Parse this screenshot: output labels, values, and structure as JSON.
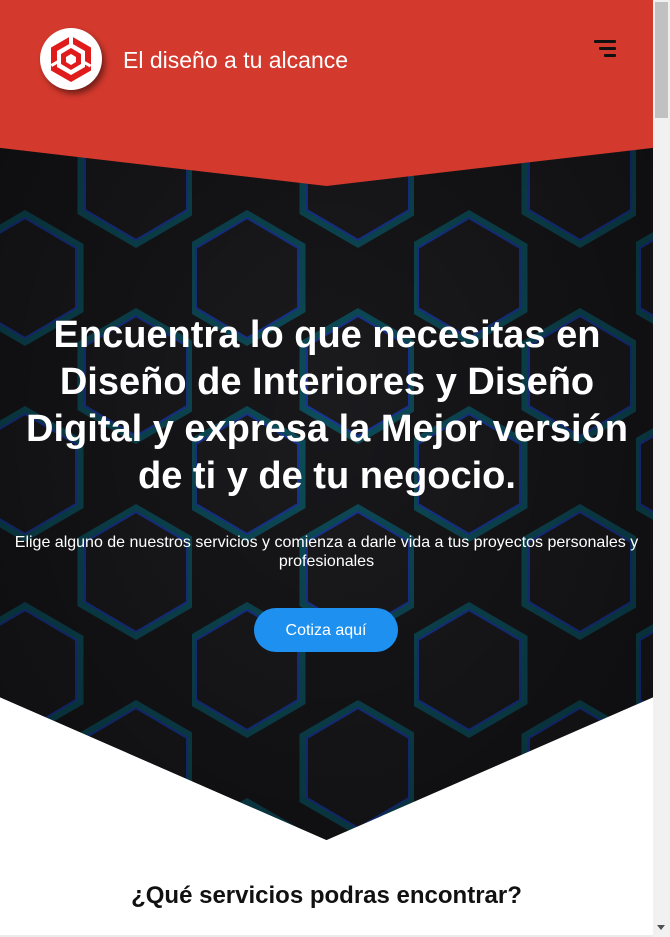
{
  "header": {
    "brand": "El diseño a tu alcance",
    "logo_icon": "hexagon-logo-icon",
    "menu_icon": "menu-icon",
    "background_color": "#d3392d"
  },
  "hero": {
    "title": "Encuentra lo que necesitas en Diseño de Interiores y Diseño Digital y expresa la Mejor versión de ti y de tu negocio.",
    "subtitle": "Elige alguno de nuestros servicios y comienza a darle vida a tus proyectos personales y profesionales",
    "cta_label": "Cotiza aquí",
    "cta_color": "#1e90f0"
  },
  "services": {
    "title": "¿Qué servicios podras encontrar?"
  }
}
